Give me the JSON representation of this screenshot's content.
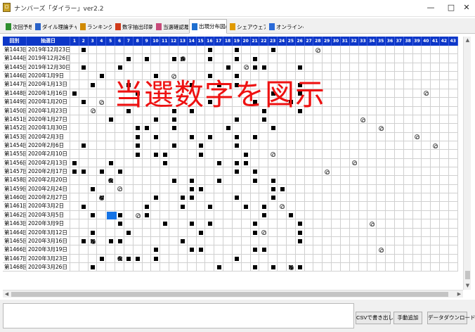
{
  "window": {
    "title": "ナンバーズ「ダイラー」ver2.2",
    "min_icon": "minimize-icon",
    "max_icon": "maximize-icon",
    "close_icon": "close-icon"
  },
  "tabs": [
    {
      "label": "次回予想",
      "icon": "prediction-icon",
      "color": "#2f8f2f"
    },
    {
      "label": "ダイル理論チャート",
      "icon": "chart-icon",
      "color": "#2962c8"
    },
    {
      "label": "ランキング設定",
      "icon": "ranking-icon",
      "color": "#d08a00"
    },
    {
      "label": "数字抽出印刷",
      "icon": "print-icon",
      "color": "#d03a1a"
    },
    {
      "label": "当選確認履歴",
      "icon": "history-icon",
      "color": "#c84a7a"
    },
    {
      "label": "出現分布図/DL",
      "icon": "distribution-icon",
      "color": "#1f6fd0",
      "active": true
    },
    {
      "label": "シェアウェア登録",
      "icon": "register-icon",
      "color": "#e09a00"
    },
    {
      "label": "オンラインヘルプ",
      "icon": "help-icon",
      "color": "#2a6ad8"
    }
  ],
  "grid": {
    "header_round": "回別",
    "header_date": "抽選日",
    "number_columns": [
      "1",
      "2",
      "3",
      "4",
      "5",
      "6",
      "7",
      "8",
      "9",
      "10",
      "11",
      "12",
      "13",
      "14",
      "15",
      "16",
      "17",
      "18",
      "19",
      "20",
      "21",
      "22",
      "23",
      "24",
      "25",
      "26",
      "27",
      "28",
      "29",
      "30",
      "31",
      "32",
      "33",
      "34",
      "35",
      "36",
      "37",
      "38",
      "39",
      "40",
      "41",
      "42",
      "43"
    ],
    "rows": [
      {
        "round": "第1443回",
        "date": "2019年12月23日"
      },
      {
        "round": "第1444回",
        "date": "2019年12月26日"
      },
      {
        "round": "第1445回",
        "date": "2019年12月30日"
      },
      {
        "round": "第1446回",
        "date": "2020年1月9日"
      },
      {
        "round": "第1447回",
        "date": "2020年1月13日"
      },
      {
        "round": "第1448回",
        "date": "2020年1月16日"
      },
      {
        "round": "第1449回",
        "date": "2020年1月20日"
      },
      {
        "round": "第1450回",
        "date": "2020年1月23日"
      },
      {
        "round": "第1451回",
        "date": "2020年1月27日"
      },
      {
        "round": "第1452回",
        "date": "2020年1月30日"
      },
      {
        "round": "第1453回",
        "date": "2020年2月3日"
      },
      {
        "round": "第1454回",
        "date": "2020年2月6日"
      },
      {
        "round": "第1455回",
        "date": "2020年2月10日"
      },
      {
        "round": "第1456回",
        "date": "2020年2月13日"
      },
      {
        "round": "第1457回",
        "date": "2020年2月17日"
      },
      {
        "round": "第1458回",
        "date": "2020年2月20日"
      },
      {
        "round": "第1459回",
        "date": "2020年2月24日"
      },
      {
        "round": "第1460回",
        "date": "2020年2月27日"
      },
      {
        "round": "第1461回",
        "date": "2020年3月2日"
      },
      {
        "round": "第1462回",
        "date": "2020年3月5日"
      },
      {
        "round": "第1463回",
        "date": "2020年3月9日"
      },
      {
        "round": "第1464回",
        "date": "2020年3月12日"
      },
      {
        "round": "第1465回",
        "date": "2020年3月16日"
      },
      {
        "round": "第1466回",
        "date": "2020年3月19日"
      },
      {
        "round": "第1467回",
        "date": "2020年3月23日"
      },
      {
        "round": "第1468回",
        "date": "2020年3月26日"
      }
    ],
    "marks": [
      [
        2,
        16,
        19,
        23
      ],
      [
        7,
        9,
        12,
        13,
        16,
        19,
        21
      ],
      [
        2,
        6,
        18,
        21,
        22,
        26
      ],
      [
        4,
        10,
        16,
        19
      ],
      [
        3,
        7,
        14,
        17,
        19,
        26
      ],
      [
        1,
        8,
        23,
        26
      ],
      [
        2,
        16,
        21,
        25
      ],
      [
        7,
        12,
        14,
        22,
        26
      ],
      [
        5,
        10,
        12,
        19,
        22
      ],
      [
        8,
        9,
        12,
        18,
        23
      ],
      [
        8,
        10,
        14,
        16,
        19,
        21
      ],
      [
        2,
        8,
        12,
        15,
        19
      ],
      [
        8,
        10,
        11,
        15,
        20
      ],
      [
        1,
        5,
        11,
        17,
        19,
        20
      ],
      [
        1,
        2,
        4,
        6,
        19,
        21
      ],
      [
        5,
        12,
        14,
        17,
        21,
        23
      ],
      [
        3,
        14,
        15,
        23,
        24
      ],
      [
        4,
        10,
        13,
        14,
        19,
        23
      ],
      [
        2,
        9,
        13,
        16,
        20,
        22
      ],
      [
        3,
        6,
        9,
        22,
        25
      ],
      [
        6,
        11,
        14,
        16,
        21,
        26
      ],
      [
        3,
        7,
        15,
        21,
        26
      ],
      [
        2,
        3,
        5,
        6,
        13,
        26
      ],
      [
        10,
        14,
        15,
        21,
        22
      ],
      [
        4,
        6,
        7,
        8,
        10,
        19
      ],
      [
        3,
        17,
        21,
        23,
        25,
        26
      ]
    ],
    "bonus": [
      {
        "row": 0,
        "col": 28
      },
      {
        "row": 1,
        "col": 13
      },
      {
        "row": 2,
        "col": 20
      },
      {
        "row": 3,
        "col": 12
      },
      {
        "row": 5,
        "col": 40
      },
      {
        "row": 6,
        "col": 4
      },
      {
        "row": 7,
        "col": 3
      },
      {
        "row": 8,
        "col": 33
      },
      {
        "row": 9,
        "col": 35
      },
      {
        "row": 10,
        "col": 39
      },
      {
        "row": 11,
        "col": 41
      },
      {
        "row": 12,
        "col": 23
      },
      {
        "row": 13,
        "col": 32
      },
      {
        "row": 14,
        "col": 29
      },
      {
        "row": 15,
        "col": 5
      },
      {
        "row": 16,
        "col": 6
      },
      {
        "row": 17,
        "col": 4
      },
      {
        "row": 18,
        "col": 24
      },
      {
        "row": 19,
        "col": 8
      },
      {
        "row": 20,
        "col": 34
      },
      {
        "row": 21,
        "col": 22
      },
      {
        "row": 22,
        "col": 3
      },
      {
        "row": 23,
        "col": 35
      },
      {
        "row": 24,
        "col": 6
      },
      {
        "row": 25,
        "col": 25
      }
    ],
    "selected": {
      "row": 19,
      "col": 5,
      "color": "#1473e6"
    }
  },
  "overlay_text": "当選数字を図示",
  "buttons": {
    "csv": "CSVで書き出し",
    "manual": "手動追加",
    "download": "データダウンロード"
  }
}
